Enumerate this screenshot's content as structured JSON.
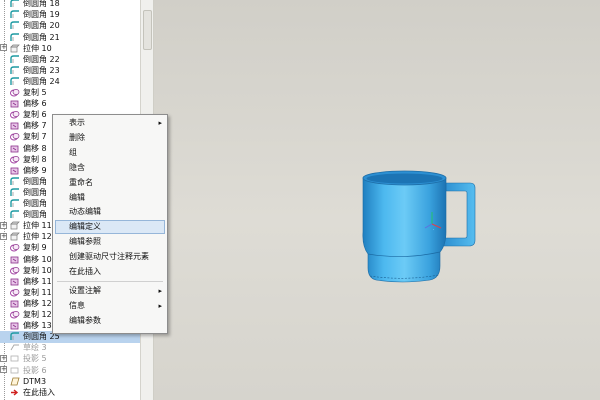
{
  "tree": {
    "items": [
      {
        "label": "倒圆角 18",
        "icon": "round-icon"
      },
      {
        "label": "倒圆角 19",
        "icon": "round-icon"
      },
      {
        "label": "倒圆角 20",
        "icon": "round-icon"
      },
      {
        "label": "倒圆角 21",
        "icon": "round-icon"
      },
      {
        "label": "拉伸 10",
        "icon": "extrude-icon",
        "expander": "+"
      },
      {
        "label": "倒圆角 22",
        "icon": "round-icon"
      },
      {
        "label": "倒圆角 23",
        "icon": "round-icon"
      },
      {
        "label": "倒圆角 24",
        "icon": "round-icon"
      },
      {
        "label": "复制 5",
        "icon": "copy-icon"
      },
      {
        "label": "偏移 6",
        "icon": "offset-icon"
      },
      {
        "label": "复制 6",
        "icon": "copy-icon"
      },
      {
        "label": "偏移 7",
        "icon": "offset-icon"
      },
      {
        "label": "复制 7",
        "icon": "copy-icon"
      },
      {
        "label": "偏移 8",
        "icon": "offset-icon"
      },
      {
        "label": "复制 8",
        "icon": "copy-icon"
      },
      {
        "label": "偏移 9",
        "icon": "offset-icon"
      },
      {
        "label": "倒圆角",
        "icon": "round-icon"
      },
      {
        "label": "倒圆角",
        "icon": "round-icon"
      },
      {
        "label": "倒圆角",
        "icon": "round-icon"
      },
      {
        "label": "倒圆角",
        "icon": "round-icon"
      },
      {
        "label": "拉伸 11",
        "icon": "extrude-icon",
        "expander": "+"
      },
      {
        "label": "拉伸 12",
        "icon": "extrude-icon",
        "expander": "+"
      },
      {
        "label": "复制 9",
        "icon": "copy-icon"
      },
      {
        "label": "偏移 10",
        "icon": "offset-icon"
      },
      {
        "label": "复制 10",
        "icon": "copy-icon"
      },
      {
        "label": "偏移 11",
        "icon": "offset-icon"
      },
      {
        "label": "复制 11",
        "icon": "copy-icon"
      },
      {
        "label": "偏移 12",
        "icon": "offset-icon"
      },
      {
        "label": "复制 12",
        "icon": "copy-icon"
      },
      {
        "label": "偏移 13",
        "icon": "offset-icon"
      },
      {
        "label": "倒圆角 25",
        "icon": "round-icon",
        "selected": true
      },
      {
        "label": "草绘 3",
        "icon": "sketch-icon",
        "faded": true
      },
      {
        "label": "投影 5",
        "icon": "projection-icon",
        "faded": true,
        "expander": "+"
      },
      {
        "label": "投影 6",
        "icon": "projection-icon",
        "faded": true,
        "expander": "+"
      },
      {
        "label": "DTM3",
        "icon": "datum-plane-icon"
      },
      {
        "label": "在此插入",
        "icon": "insert-here-arrow-icon"
      }
    ]
  },
  "context_menu": {
    "items": [
      {
        "label": "表示",
        "submenu": true
      },
      {
        "label": "删除"
      },
      {
        "label": "组"
      },
      {
        "label": "隐含"
      },
      {
        "label": "重命名"
      },
      {
        "label": "编辑"
      },
      {
        "label": "动态编辑"
      },
      {
        "label": "编辑定义",
        "highlighted": true
      },
      {
        "label": "编辑参照"
      },
      {
        "label": "创建驱动尺寸注释元素"
      },
      {
        "label": "在此插入",
        "separator_after": true
      },
      {
        "label": "设置注解",
        "submenu": true
      },
      {
        "label": "信息",
        "submenu": true
      },
      {
        "label": "编辑参数"
      }
    ],
    "submenu_arrow": "▸"
  },
  "colors": {
    "model": "#3fa8e0",
    "highlight": "#dbe8f6",
    "selected_row": "#b9d3ee"
  }
}
